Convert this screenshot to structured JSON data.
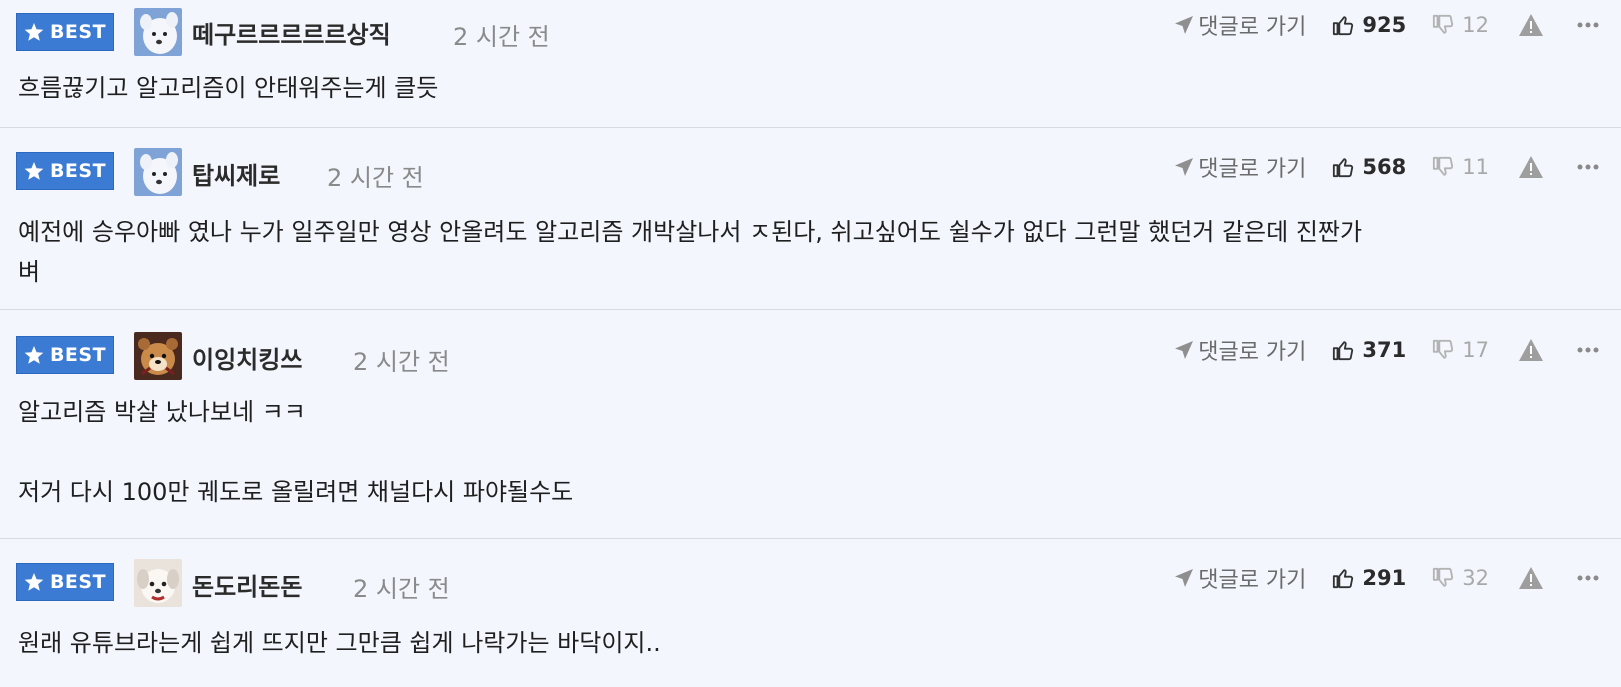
{
  "ui": {
    "best_label": "BEST",
    "goto_label": "댓글로 가기"
  },
  "colors": {
    "badge": "#3b7bd4",
    "background": "#f3f6fd",
    "muted": "#8a8a8a"
  },
  "comments": [
    {
      "author": "떼구르르르르르상직",
      "time": "2 시간 전",
      "likes": "925",
      "dislikes": "12",
      "avatar_icon": "white-dog-avatar-icon",
      "lines": [
        "흐름끊기고 알고리즘이 안태워주는게 클듯"
      ]
    },
    {
      "author": "탑씨제로",
      "time": "2 시간 전",
      "likes": "568",
      "dislikes": "11",
      "avatar_icon": "white-dog-avatar-icon",
      "lines": [
        "예전에 승우아빠 였나 누가 일주일만 영상 안올려도 알고리즘 개박살나서 ㅈ된다, 쉬고싶어도 쉴수가 없다 그런말 했던거 같은데 진짠가",
        "벼"
      ]
    },
    {
      "author": "이잉치킹쓰",
      "time": "2 시간 전",
      "likes": "371",
      "dislikes": "17",
      "avatar_icon": "brown-animal-avatar-icon",
      "lines": [
        "알고리즘 박살 났나보네 ㅋㅋ",
        "",
        "저거 다시 100만 궤도로 올릴려면 채널다시 파야될수도"
      ]
    },
    {
      "author": "돈도리돈돈",
      "time": "2 시간 전",
      "likes": "291",
      "dislikes": "32",
      "avatar_icon": "white-puppy-avatar-icon",
      "lines": [
        "원래 유튜브라는게 쉽게 뜨지만 그만큼 쉽게 나락가는 바닥이지.."
      ]
    }
  ]
}
